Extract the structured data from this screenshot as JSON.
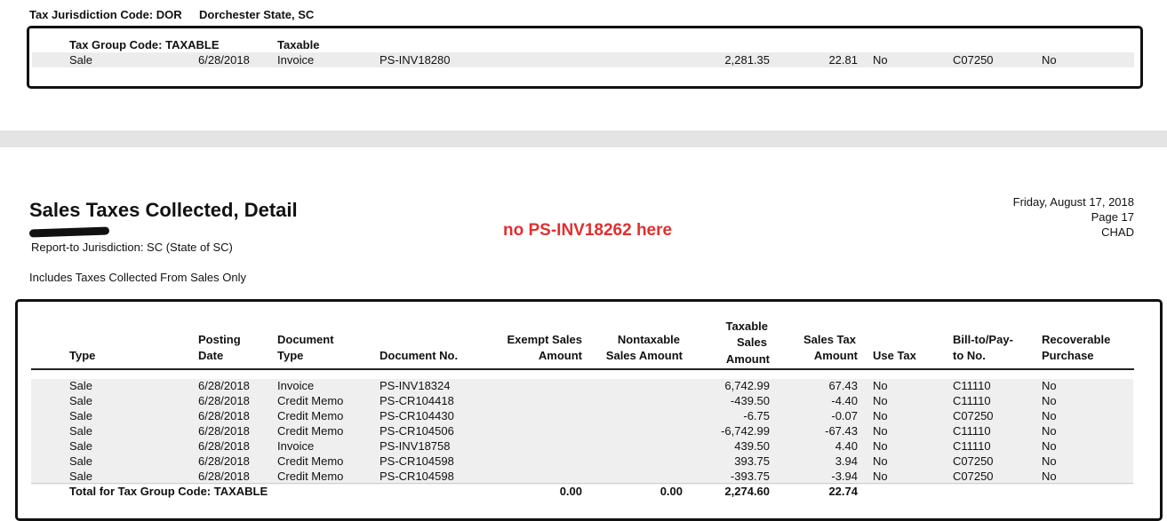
{
  "top": {
    "jurisdiction_label": "Tax Jurisdiction Code: DOR",
    "jurisdiction_name": "Dorchester State, SC",
    "group_label": "Tax Group Code: TAXABLE",
    "group_name": "Taxable",
    "row": {
      "type": "Sale",
      "date": "6/28/2018",
      "doctype": "Invoice",
      "docno": "PS-INV18280",
      "taxable": "2,281.35",
      "tax": "22.81",
      "usetax": "No",
      "billto": "C07250",
      "recoverable": "No"
    }
  },
  "report": {
    "title": "Sales Taxes Collected, Detail",
    "report_to": "Report-to Jurisdiction: SC  (State of SC)",
    "includes": "Includes Taxes Collected From Sales Only",
    "annotation": "no PS-INV18262 here",
    "date": "Friday, August 17, 2018",
    "page": "Page 17",
    "user": "CHAD"
  },
  "table": {
    "headers": {
      "type": "Type",
      "posting1": "Posting",
      "posting2": "Date",
      "doctype1": "Document",
      "doctype2": "Type",
      "docno": "Document No.",
      "exempt1": "Exempt Sales",
      "exempt2": "Amount",
      "nontax1": "Nontaxable",
      "nontax2": "Sales Amount",
      "taxable1": "Taxable",
      "taxable2": "Sales",
      "taxable3": "Amount",
      "salestax1": "Sales Tax",
      "salestax2": "Amount",
      "usetax": "Use Tax",
      "billto1": "Bill-to/Pay-",
      "billto2": "to No.",
      "recov1": "Recoverable",
      "recov2": "Purchase"
    },
    "rows": [
      {
        "type": "Sale",
        "date": "6/28/2018",
        "doctype": "Invoice",
        "docno": "PS-INV18324",
        "taxable": "6,742.99",
        "tax": "67.43",
        "usetax": "No",
        "billto": "C11110",
        "recoverable": "No"
      },
      {
        "type": "Sale",
        "date": "6/28/2018",
        "doctype": "Credit Memo",
        "docno": "PS-CR104418",
        "taxable": "-439.50",
        "tax": "-4.40",
        "usetax": "No",
        "billto": "C11110",
        "recoverable": "No"
      },
      {
        "type": "Sale",
        "date": "6/28/2018",
        "doctype": "Credit Memo",
        "docno": "PS-CR104430",
        "taxable": "-6.75",
        "tax": "-0.07",
        "usetax": "No",
        "billto": "C07250",
        "recoverable": "No"
      },
      {
        "type": "Sale",
        "date": "6/28/2018",
        "doctype": "Credit Memo",
        "docno": "PS-CR104506",
        "taxable": "-6,742.99",
        "tax": "-67.43",
        "usetax": "No",
        "billto": "C11110",
        "recoverable": "No"
      },
      {
        "type": "Sale",
        "date": "6/28/2018",
        "doctype": "Invoice",
        "docno": "PS-INV18758",
        "taxable": "439.50",
        "tax": "4.40",
        "usetax": "No",
        "billto": "C11110",
        "recoverable": "No"
      },
      {
        "type": "Sale",
        "date": "6/28/2018",
        "doctype": "Credit Memo",
        "docno": "PS-CR104598",
        "taxable": "393.75",
        "tax": "3.94",
        "usetax": "No",
        "billto": "C07250",
        "recoverable": "No"
      },
      {
        "type": "Sale",
        "date": "6/28/2018",
        "doctype": "Credit Memo",
        "docno": "PS-CR104598",
        "taxable": "-393.75",
        "tax": "-3.94",
        "usetax": "No",
        "billto": "C07250",
        "recoverable": "No"
      }
    ],
    "total": {
      "label": "Total for Tax Group Code: TAXABLE",
      "exempt": "0.00",
      "nontax": "0.00",
      "taxable": "2,274.60",
      "tax": "22.74"
    }
  }
}
